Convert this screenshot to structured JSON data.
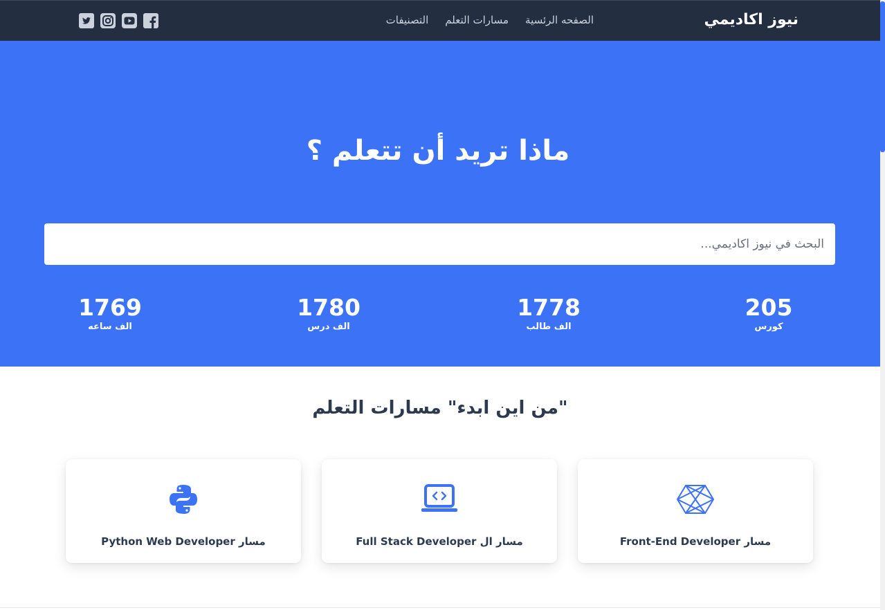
{
  "navbar": {
    "brand": "نيوز اكاديمي",
    "links": [
      {
        "label": "الصفحه الرئسية"
      },
      {
        "label": "مسارات التعلم"
      },
      {
        "label": "التصنيفات"
      }
    ],
    "socials": [
      "facebook-icon",
      "youtube-icon",
      "instagram-icon",
      "twitter-icon"
    ]
  },
  "hero": {
    "title": "ماذا تريد أن تتعلم ؟",
    "search_placeholder": "البحث في نيوز اكاديمي...",
    "stats": [
      {
        "value": "205",
        "label": "كورس"
      },
      {
        "value": "1778",
        "label": "الف طالب"
      },
      {
        "value": "1780",
        "label": "الف درس"
      },
      {
        "value": "1769",
        "label": "الف ساعه"
      }
    ]
  },
  "paths": {
    "title": "\"من اين ابدء\" مسارات التعلم",
    "cards": [
      {
        "label": "مسار Front-End Developer",
        "icon": "html-cube-icon"
      },
      {
        "label": "مسار ال Full Stack Developer",
        "icon": "laptop-code-icon"
      },
      {
        "label": "مسار Python Web Developer",
        "icon": "python-icon"
      }
    ]
  },
  "colors": {
    "navbar": "#232e40",
    "accent": "#3c72f6",
    "heading": "#2d3a4e"
  }
}
